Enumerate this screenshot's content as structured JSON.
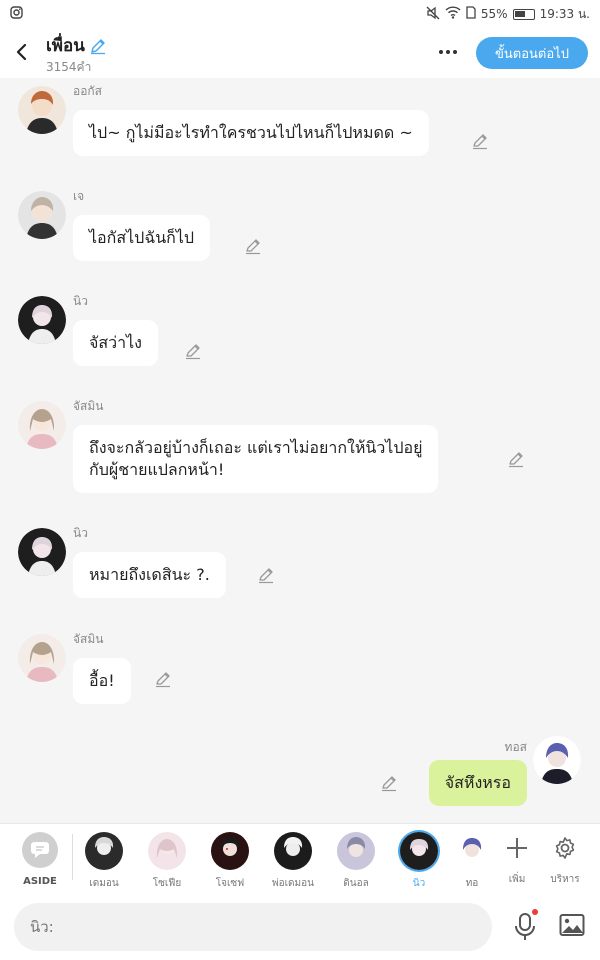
{
  "status_bar": {
    "battery": "55%",
    "time": "19:33 น.",
    "icons": [
      "instagram-icon",
      "mute-icon",
      "wifi-icon",
      "sim-icon",
      "battery-icon"
    ]
  },
  "header": {
    "title": "เพื่อน",
    "subtitle": "3154คำ",
    "next_label": "ขั้นตอนต่อไป"
  },
  "messages": [
    {
      "side": "left",
      "name": "ออกัส",
      "text": "ไป~ กูไม่มีอะไรทำใครชวนไปไหนก็ไปหมดด ~"
    },
    {
      "side": "left",
      "name": "เจ",
      "text": "ไอกัสไปฉันก็ไป"
    },
    {
      "side": "left",
      "name": "นิว",
      "text": "จัสว่าไง"
    },
    {
      "side": "left",
      "name": "จัสมิน",
      "text_lines": [
        "ถึงจะกลัวอยู่บ้างก็เถอะ แต่เราไม่อยากให้นิวไปอยู่",
        "กับผู้ชายแปลกหน้า!"
      ]
    },
    {
      "side": "left",
      "name": "นิว",
      "text": "หมายถึงเดสินะ ?."
    },
    {
      "side": "left",
      "name": "จัสมิน",
      "text": "อื้อ!"
    },
    {
      "side": "right",
      "name": "ทอส",
      "text": "จัสหึงหรอ"
    }
  ],
  "character_bar": {
    "aside_label": "ASIDE",
    "characters": [
      {
        "label": "เดมอน",
        "active": false
      },
      {
        "label": "โซเฟีย",
        "active": false
      },
      {
        "label": "โจเซฟ",
        "active": false
      },
      {
        "label": "พ่อเดมอน",
        "active": false
      },
      {
        "label": "ดินอล",
        "active": false
      },
      {
        "label": "นิว",
        "active": true
      },
      {
        "label": "ทอ",
        "active": false
      }
    ],
    "add_label": "เพิ่ม",
    "manage_label": "บริหาร"
  },
  "input": {
    "placeholder": "นิว:"
  },
  "colors": {
    "accent": "#4aa9ee",
    "own_bubble": "#d9f29b",
    "other_bubble": "#ffffff",
    "background": "#f5f5f5"
  }
}
